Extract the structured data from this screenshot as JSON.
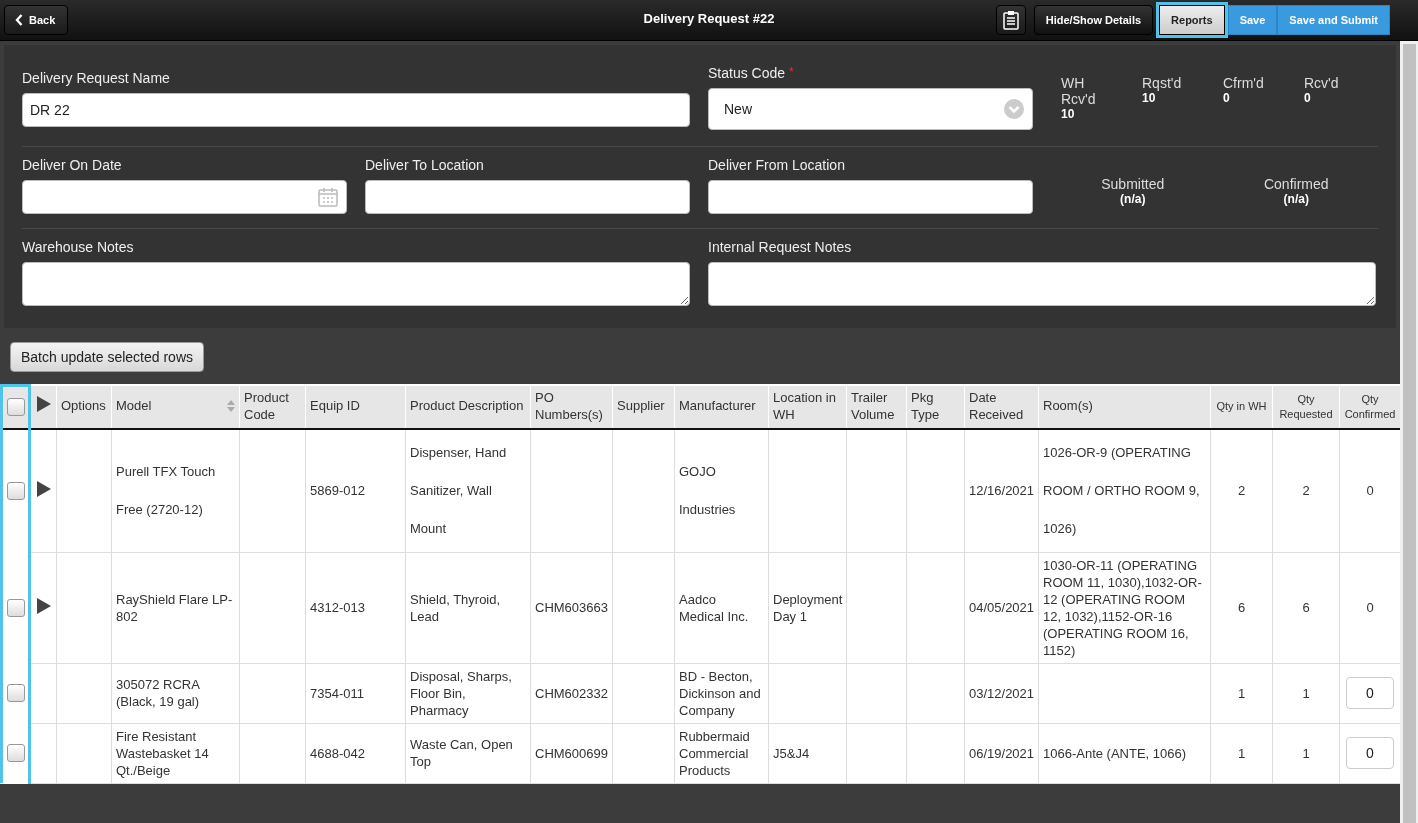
{
  "header": {
    "back": "Back",
    "title": "Delivery Request #22",
    "buttons": [
      {
        "label": "Hide/Show Details",
        "kind": "dark",
        "highlighted": false
      },
      {
        "label": "Reports",
        "kind": "light",
        "highlighted": true
      },
      {
        "label": "Save",
        "kind": "blue",
        "highlighted": false
      },
      {
        "label": "Save and Submit",
        "kind": "blue",
        "highlighted": false
      }
    ]
  },
  "form": {
    "name": {
      "label": "Delivery Request Name",
      "value": "DR 22"
    },
    "status": {
      "label": "Status Code",
      "required_mark": "*",
      "value": "New"
    },
    "stats": [
      {
        "label": "WH Rcv'd",
        "value": "10"
      },
      {
        "label": "Rqst'd",
        "value": "10"
      },
      {
        "label": "Cfrm'd",
        "value": "0"
      },
      {
        "label": "Rcv'd",
        "value": "0"
      }
    ],
    "deliver_on": {
      "label": "Deliver On Date"
    },
    "deliver_to": {
      "label": "Deliver To Location"
    },
    "deliver_from": {
      "label": "Deliver From Location"
    },
    "dates": [
      {
        "label": "Submitted",
        "value": "(n/a)"
      },
      {
        "label": "Confirmed",
        "value": "(n/a)"
      }
    ],
    "warehouse_notes": {
      "label": "Warehouse Notes"
    },
    "internal_notes": {
      "label": "Internal Request Notes"
    }
  },
  "batch_button": "Batch update selected rows",
  "table": {
    "select_all_checked": false,
    "checkbox_column_highlighted": true,
    "columns": [
      {
        "label": "Options",
        "sortable": false
      },
      {
        "label": "Model",
        "sortable": true
      },
      {
        "label": "Product Code",
        "sortable": false
      },
      {
        "label": "Equip ID",
        "sortable": false
      },
      {
        "label": "Product Description",
        "sortable": false
      },
      {
        "label": "PO Numbers(s)",
        "sortable": false
      },
      {
        "label": "Supplier",
        "sortable": false
      },
      {
        "label": "Manufacturer",
        "sortable": false
      },
      {
        "label": "Location in WH",
        "sortable": false
      },
      {
        "label": "Trailer Volume",
        "sortable": false
      },
      {
        "label": "Pkg Type",
        "sortable": false
      },
      {
        "label": "Date Received",
        "sortable": false
      },
      {
        "label": "Room(s)",
        "sortable": false
      },
      {
        "label": "Qty in WH",
        "sortable": false
      },
      {
        "label": "Qty Requested",
        "sortable": false
      },
      {
        "label": "Qty Confirmed",
        "sortable": false
      }
    ],
    "rows": [
      {
        "checked": false,
        "expandable": true,
        "spaced": true,
        "model": "Purell TFX Touch Free (2720-12)",
        "equip_id": "5869-012",
        "description": "Dispenser, Hand Sanitizer, Wall Mount",
        "manufacturer": "GOJO Industries",
        "date_received": "12/16/2021",
        "rooms": "1026-OR-9 (OPERATING ROOM / ORTHO ROOM 9, 1026)",
        "qty_wh": "2",
        "qty_requested": "2",
        "qty_confirmed": {
          "kind": "text",
          "value": "0"
        }
      },
      {
        "checked": false,
        "expandable": true,
        "spaced": false,
        "model": "RayShield Flare LP-802",
        "equip_id": "4312-013",
        "description": "Shield, Thyroid, Lead",
        "po": "CHM603663",
        "manufacturer": "Aadco Medical Inc.",
        "location": "Deployment Day 1",
        "date_received": "04/05/2021",
        "rooms": "1030-OR-11 (OPERATING ROOM 11, 1030),1032-OR-12 (OPERATING ROOM 12, 1032),1152-OR-16 (OPERATING ROOM 16, 1152)",
        "qty_wh": "6",
        "qty_requested": "6",
        "qty_confirmed": {
          "kind": "text",
          "value": "0"
        }
      },
      {
        "checked": false,
        "expandable": false,
        "spaced": false,
        "model": "305072 RCRA (Black, 19 gal)",
        "equip_id": "7354-011",
        "description": "Disposal, Sharps, Floor Bin, Pharmacy",
        "po": "CHM602332",
        "manufacturer": "BD - Becton, Dickinson and Company",
        "date_received": "03/12/2021",
        "qty_wh": "1",
        "qty_requested": "1",
        "qty_confirmed": {
          "kind": "input",
          "value": "0"
        }
      },
      {
        "checked": false,
        "expandable": false,
        "spaced": false,
        "model": "Fire Resistant Wastebasket 14 Qt./Beige",
        "equip_id": "4688-042",
        "description": "Waste Can, Open Top",
        "po": "CHM600699",
        "manufacturer": "Rubbermaid Commercial Products",
        "location": "J5&J4",
        "date_received": "06/19/2021",
        "rooms": "1066-Ante (ANTE, 1066)",
        "qty_wh": "1",
        "qty_requested": "1",
        "qty_confirmed": {
          "kind": "input",
          "value": "0"
        }
      }
    ]
  }
}
